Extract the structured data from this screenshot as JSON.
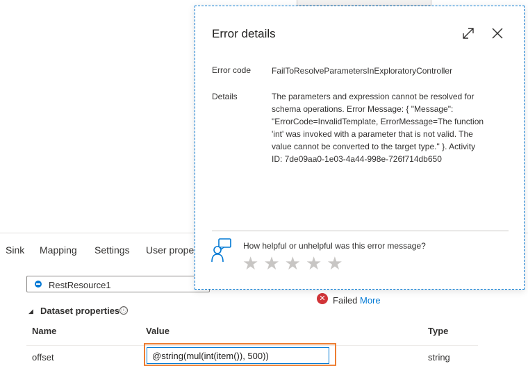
{
  "tabs": [
    {
      "label": "Sink"
    },
    {
      "label": "Mapping"
    },
    {
      "label": "Settings"
    },
    {
      "label": "User prope"
    }
  ],
  "dataset": {
    "selected": "RestResource1"
  },
  "status": {
    "icon": "error-circle-icon",
    "text": "Failed",
    "link": "More"
  },
  "dataset_properties": {
    "title": "Dataset properties",
    "info_icon": "ⓘ",
    "columns": {
      "name": "Name",
      "value": "Value",
      "type": "Type"
    },
    "rows": [
      {
        "name": "offset",
        "value": "@string(mul(int(item()), 500))",
        "type": "string"
      }
    ]
  },
  "dialog": {
    "title": "Error details",
    "expand_icon": "expand-icon",
    "close_icon": "close-icon",
    "error_code_label": "Error code",
    "error_code": "FailToResolveParametersInExploratoryController",
    "details_label": "Details",
    "details_lines": [
      "The parameters and expression cannot be resolved for",
      "schema operations. Error Message: { \"Message\":",
      "\"ErrorCode=InvalidTemplate, ErrorMessage=The function",
      "'int' was invoked with a parameter that is not valid. The",
      "value cannot be converted to the target type.\" }. Activity",
      "ID: 7de09aa0-1e03-4a44-998e-726f714db650"
    ],
    "feedback_question": "How helpful or unhelpful was this error message?",
    "rating": {
      "stars": 5,
      "filled": 0
    }
  },
  "colors": {
    "accent": "#0078d4",
    "error": "#d13438",
    "highlight": "#ed7d31",
    "star_empty": "#c8c6c4"
  }
}
